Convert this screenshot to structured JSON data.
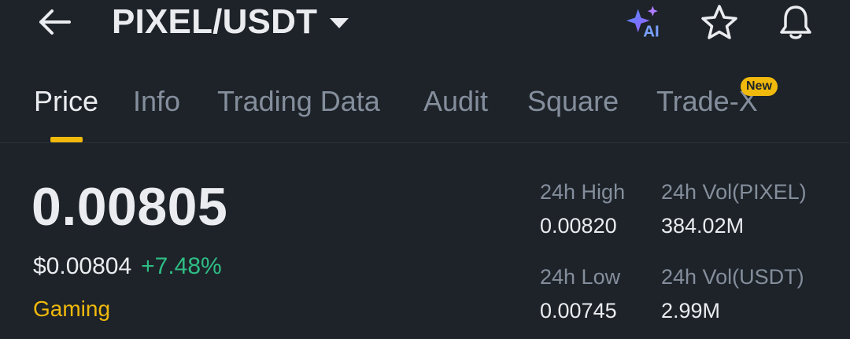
{
  "header": {
    "pair_title": "PIXEL/USDT",
    "icons": {
      "back": "back-arrow-icon",
      "ai": "ai-sparkle-icon",
      "favorite": "star-icon",
      "alert": "bell-icon"
    },
    "ai_label": "AI"
  },
  "tabs": [
    {
      "label": "Price",
      "active": true
    },
    {
      "label": "Info",
      "active": false
    },
    {
      "label": "Trading Data",
      "active": false
    },
    {
      "label": "Audit",
      "active": false
    },
    {
      "label": "Square",
      "active": false
    },
    {
      "label": "Trade-X",
      "active": false,
      "badge": "New"
    }
  ],
  "price": {
    "last": "0.00805",
    "fiat": "$0.00804",
    "change": "+7.48%",
    "tag": "Gaming"
  },
  "stats": {
    "high_label": "24h High",
    "high_value": "0.00820",
    "vol_base_label": "24h Vol(PIXEL)",
    "vol_base_value": "384.02M",
    "low_label": "24h Low",
    "low_value": "0.00745",
    "vol_quote_label": "24h Vol(USDT)",
    "vol_quote_value": "2.99M"
  },
  "colors": {
    "background": "#1e2329",
    "accent": "#f0b90b",
    "positive": "#2ebd85",
    "muted": "#848e9c",
    "text": "#eaecef"
  }
}
